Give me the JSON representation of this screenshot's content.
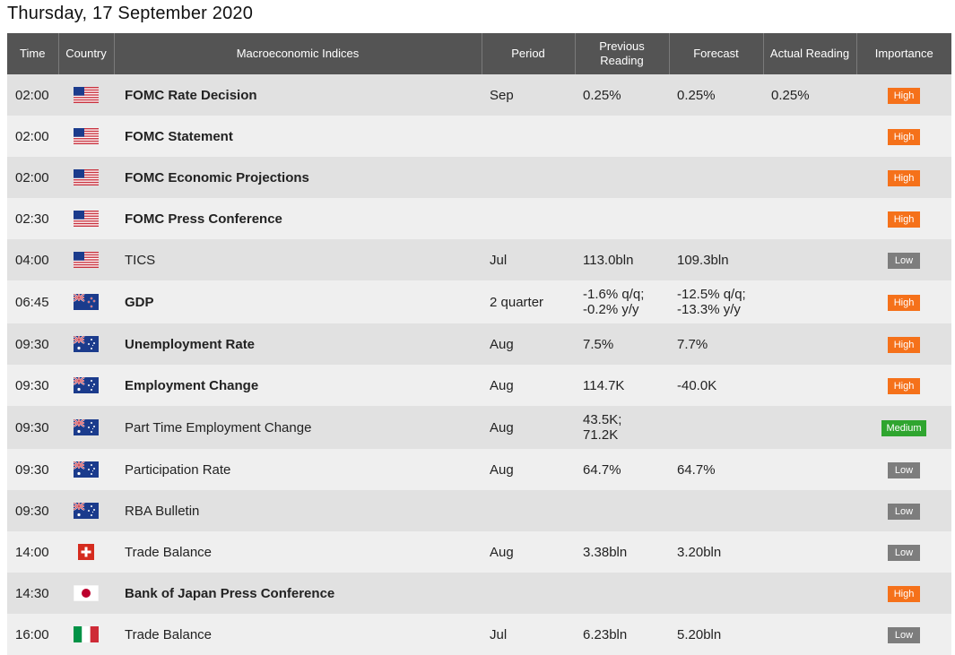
{
  "page": {
    "date_title": "Thursday, 17 September 2020"
  },
  "colors": {
    "header_bg": "#545454",
    "row_dark": "#e1e1e1",
    "row_light": "#efefef",
    "high": "#f5711a",
    "low": "#7d7d7d",
    "medium": "#2fa52f"
  },
  "headers": {
    "time": "Time",
    "country": "Country",
    "indices": "Macroeconomic Indices",
    "period": "Period",
    "previous_1": "Previous",
    "previous_2": "Reading",
    "forecast": "Forecast",
    "actual": "Actual Reading",
    "importance": "Importance"
  },
  "rows": [
    {
      "time": "02:00",
      "flag": "us-flag-icon",
      "name": "FOMC Rate Decision",
      "bold": true,
      "period": "Sep",
      "prev1": "0.25%",
      "prev2": "",
      "fc1": "0.25%",
      "fc2": "",
      "actual": "0.25%",
      "importance": "High"
    },
    {
      "time": "02:00",
      "flag": "us-flag-icon",
      "name": "FOMC Statement",
      "bold": true,
      "period": "",
      "prev1": "",
      "prev2": "",
      "fc1": "",
      "fc2": "",
      "actual": "",
      "importance": "High"
    },
    {
      "time": "02:00",
      "flag": "us-flag-icon",
      "name": "FOMC Economic Projections",
      "bold": true,
      "period": "",
      "prev1": "",
      "prev2": "",
      "fc1": "",
      "fc2": "",
      "actual": "",
      "importance": "High"
    },
    {
      "time": "02:30",
      "flag": "us-flag-icon",
      "name": "FOMC Press Conference",
      "bold": true,
      "period": "",
      "prev1": "",
      "prev2": "",
      "fc1": "",
      "fc2": "",
      "actual": "",
      "importance": "High"
    },
    {
      "time": "04:00",
      "flag": "us-flag-icon",
      "name": "TICS",
      "bold": false,
      "period": "Jul",
      "prev1": "113.0bln",
      "prev2": "",
      "fc1": "109.3bln",
      "fc2": "",
      "actual": "",
      "importance": "Low"
    },
    {
      "time": "06:45",
      "flag": "nz-flag-icon",
      "name": "GDP",
      "bold": true,
      "period": "2 quarter",
      "prev1": "-1.6% q/q;",
      "prev2": "-0.2% y/y",
      "fc1": "-12.5% q/q;",
      "fc2": "-13.3% y/y",
      "actual": "",
      "importance": "High"
    },
    {
      "time": "09:30",
      "flag": "au-flag-icon",
      "name": "Unemployment Rate",
      "bold": true,
      "period": "Aug",
      "prev1": "7.5%",
      "prev2": "",
      "fc1": "7.7%",
      "fc2": "",
      "actual": "",
      "importance": "High"
    },
    {
      "time": "09:30",
      "flag": "au-flag-icon",
      "name": "Employment Change",
      "bold": true,
      "period": "Aug",
      "prev1": "114.7K",
      "prev2": "",
      "fc1": "-40.0K",
      "fc2": "",
      "actual": "",
      "importance": "High"
    },
    {
      "time": "09:30",
      "flag": "au-flag-icon",
      "name": "Part Time Employment Change",
      "bold": false,
      "period": "Aug",
      "prev1": "43.5K;",
      "prev2": "71.2K",
      "fc1": "",
      "fc2": "",
      "actual": "",
      "importance": "Medium"
    },
    {
      "time": "09:30",
      "flag": "au-flag-icon",
      "name": "Participation Rate",
      "bold": false,
      "period": "Aug",
      "prev1": "64.7%",
      "prev2": "",
      "fc1": "64.7%",
      "fc2": "",
      "actual": "",
      "importance": "Low"
    },
    {
      "time": "09:30",
      "flag": "au-flag-icon",
      "name": "RBA Bulletin",
      "bold": false,
      "period": "",
      "prev1": "",
      "prev2": "",
      "fc1": "",
      "fc2": "",
      "actual": "",
      "importance": "Low"
    },
    {
      "time": "14:00",
      "flag": "ch-flag-icon",
      "name": "Trade Balance",
      "bold": false,
      "period": "Aug",
      "prev1": "3.38bln",
      "prev2": "",
      "fc1": "3.20bln",
      "fc2": "",
      "actual": "",
      "importance": "Low"
    },
    {
      "time": "14:30",
      "flag": "jp-flag-icon",
      "name": "Bank of Japan Press Conference",
      "bold": true,
      "period": "",
      "prev1": "",
      "prev2": "",
      "fc1": "",
      "fc2": "",
      "actual": "",
      "importance": "High"
    },
    {
      "time": "16:00",
      "flag": "it-flag-icon",
      "name": "Trade Balance",
      "bold": false,
      "period": "Jul",
      "prev1": "6.23bln",
      "prev2": "",
      "fc1": "5.20bln",
      "fc2": "",
      "actual": "",
      "importance": "Low"
    }
  ]
}
